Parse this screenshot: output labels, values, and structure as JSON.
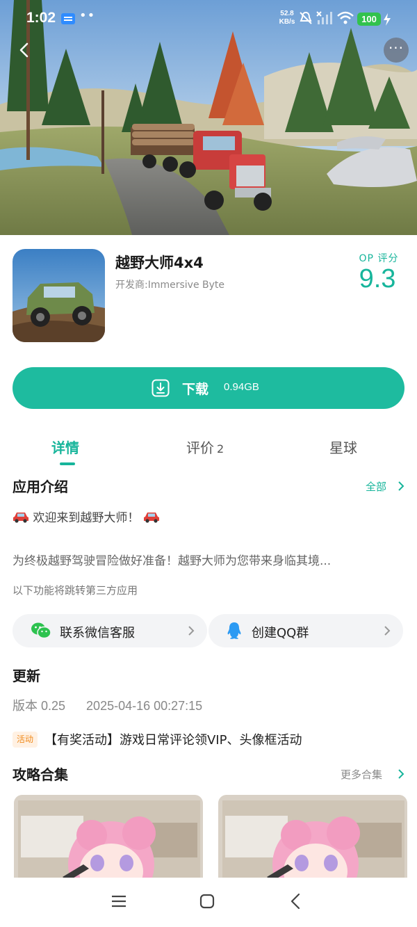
{
  "status_bar": {
    "time": "1:02",
    "net_speed_value": "52.8",
    "net_speed_unit": "KB/s",
    "battery": "100",
    "more_dots": "••"
  },
  "header": {
    "more_glyph": "···"
  },
  "app": {
    "name": "越野大师4x4",
    "developer": "开发商:Immersive Byte",
    "score_label": "OP 评分",
    "score": "9.3"
  },
  "download": {
    "label": "下载",
    "size": "0.94GB"
  },
  "tabs": [
    {
      "label": "详情",
      "count": ""
    },
    {
      "label": "评价",
      "count": "2"
    },
    {
      "label": "星球",
      "count": ""
    }
  ],
  "intro": {
    "title": "应用介绍",
    "more": "全部",
    "line1": "欢迎来到越野大师！",
    "line2": "为终极越野驾驶冒险做好准备！越野大师为您带来身临其境...",
    "third_party_note": "以下功能将跳转第三方应用"
  },
  "links": {
    "wechat": "联系微信客服",
    "qq": "创建QQ群"
  },
  "update": {
    "title": "更新",
    "version": "版本 0.25",
    "date": "2025-04-16 00:27:15"
  },
  "event": {
    "badge": "活动",
    "text": "【有奖活动】游戏日常评论领VIP、头像框活动"
  },
  "guides": {
    "title": "攻略合集",
    "more": "更多合集"
  },
  "colors": {
    "accent": "#17b59b",
    "download_bg": "#1ebb9f",
    "event_badge": "#f08a1c"
  },
  "icons": [
    "back-icon",
    "more-icon",
    "download-icon",
    "wechat-icon",
    "qq-icon",
    "chevron-right-icon",
    "car-emoji-icon",
    "menu-icon",
    "home-icon",
    "nav-back-icon"
  ]
}
